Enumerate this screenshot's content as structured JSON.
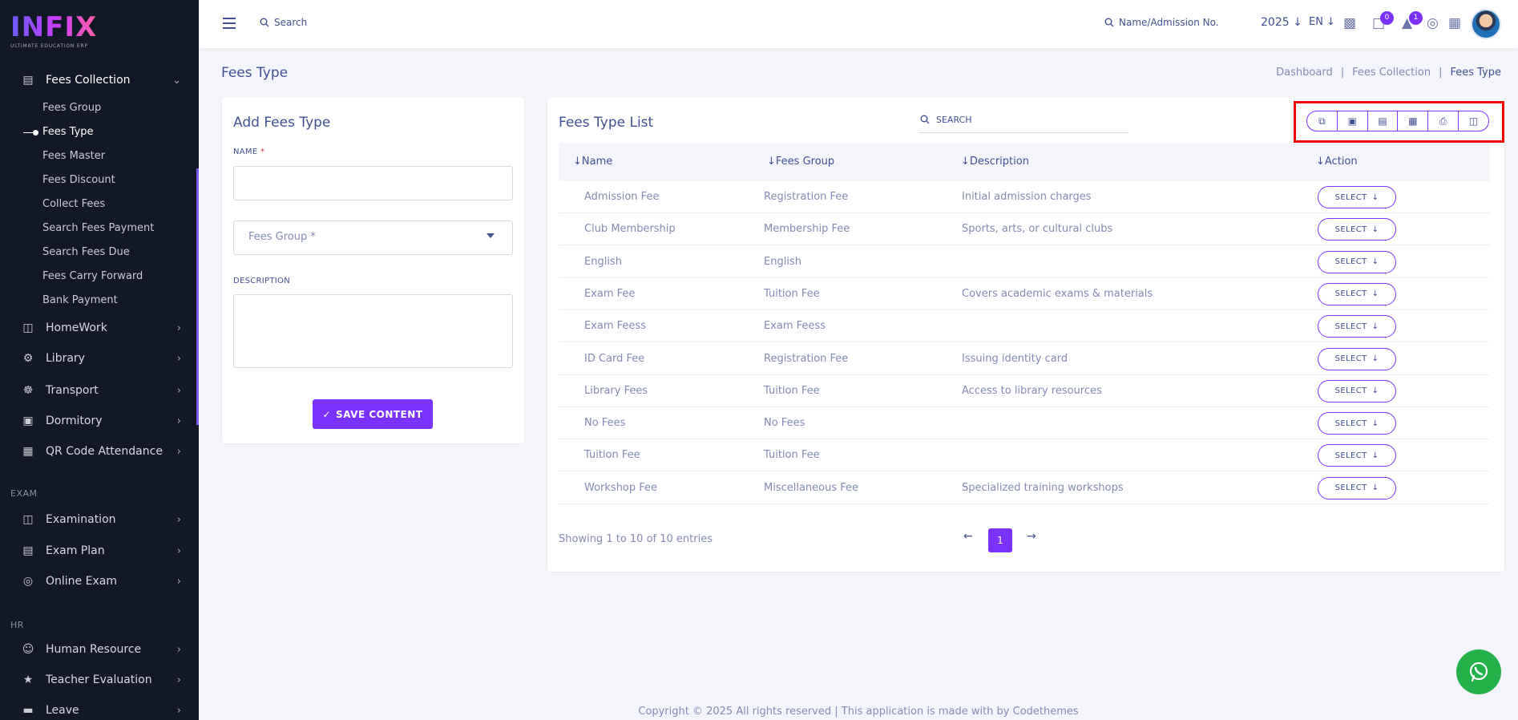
{
  "brand": {
    "logo_text": "INFIX",
    "tagline": "ULTIMATE EDUCATION ERP"
  },
  "sidebar": {
    "fees_collection": {
      "label": "Fees Collection",
      "icon": "fees-icon"
    },
    "sub_items": [
      "Fees Group",
      "Fees Type",
      "Fees Master",
      "Fees Discount",
      "Collect Fees",
      "Search Fees Payment",
      "Search Fees Due",
      "Fees Carry Forward",
      "Bank Payment"
    ],
    "menu": [
      {
        "label": "HomeWork",
        "icon": "book-icon"
      },
      {
        "label": "Library",
        "icon": "library-icon"
      },
      {
        "label": "Transport",
        "icon": "bus-icon"
      },
      {
        "label": "Dormitory",
        "icon": "bed-icon"
      },
      {
        "label": "QR Code Attendance",
        "icon": "qr-icon"
      }
    ],
    "section_exam": "EXAM",
    "exam_menu": [
      {
        "label": "Examination",
        "icon": "map-icon"
      },
      {
        "label": "Exam Plan",
        "icon": "clipboard-icon"
      },
      {
        "label": "Online Exam",
        "icon": "globe-icon"
      }
    ],
    "section_hr": "HR",
    "hr_menu": [
      {
        "label": "Human Resource",
        "icon": "people-icon"
      },
      {
        "label": "Teacher Evaluation",
        "icon": "star-icon"
      },
      {
        "label": "Leave",
        "icon": "leave-icon"
      }
    ]
  },
  "topbar": {
    "search_placeholder": "Search",
    "name_search": "Name/Admission No.",
    "year": "2025",
    "lang": "EN",
    "chat_badge": "0",
    "bell_badge": "1"
  },
  "page": {
    "title": "Fees Type",
    "breadcrumb": [
      "Dashboard",
      "Fees Collection",
      "Fees Type"
    ]
  },
  "form": {
    "title": "Add Fees Type",
    "name_label": "NAME",
    "required_mark": "*",
    "fees_group_placeholder": "Fees Group *",
    "description_label": "DESCRIPTION",
    "save_label": "SAVE CONTENT"
  },
  "list": {
    "title": "Fees Type List",
    "search_placeholder": "SEARCH",
    "columns": [
      "Name",
      "Fees Group",
      "Description",
      "Action"
    ],
    "select_label": "SELECT",
    "rows": [
      {
        "name": "Admission Fee",
        "group": "Registration Fee",
        "description": "Initial admission charges"
      },
      {
        "name": "Club Membership",
        "group": "Membership Fee",
        "description": "Sports, arts, or cultural clubs"
      },
      {
        "name": "English",
        "group": "English",
        "description": ""
      },
      {
        "name": "Exam Fee",
        "group": "Tuition Fee",
        "description": "Covers academic exams & materials"
      },
      {
        "name": "Exam Feess",
        "group": "Exam Feess",
        "description": ""
      },
      {
        "name": "ID Card Fee",
        "group": "Registration Fee",
        "description": "Issuing identity card"
      },
      {
        "name": "Library Fees",
        "group": "Tuition Fee",
        "description": "Access to library resources"
      },
      {
        "name": "No Fees",
        "group": "No Fees",
        "description": ""
      },
      {
        "name": "Tuition Fee",
        "group": "Tuition Fee",
        "description": ""
      },
      {
        "name": "Workshop Fee",
        "group": "Miscellaneous Fee",
        "description": "Specialized training workshops"
      }
    ],
    "showing": "Showing 1 to 10 of 10 entries",
    "current_page": "1"
  },
  "footer": "Copyright © 2025 All rights reserved | This application is made with by Codethemes",
  "colors": {
    "accent": "#7c32ff",
    "text": "#415094",
    "muted": "#828bb2",
    "sidebar_bg": "#121826",
    "highlight": "#e00000",
    "whatsapp": "#25b14a"
  }
}
